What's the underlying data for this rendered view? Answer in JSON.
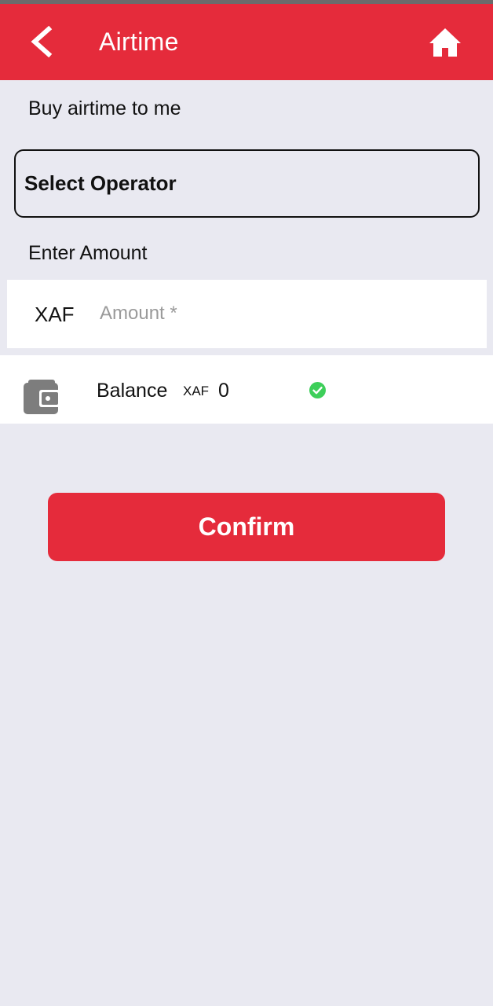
{
  "header": {
    "title": "Airtime",
    "back_icon": "chevron-left-icon",
    "home_icon": "home-icon",
    "background_color": "#e52b3b"
  },
  "form": {
    "buy_label": "Buy airtime to me",
    "operator_select_label": "Select Operator",
    "amount_label": "Enter Amount",
    "currency": "XAF",
    "amount_placeholder": "Amount *",
    "amount_value": ""
  },
  "balance": {
    "icon": "wallet-icon",
    "label": "Balance",
    "currency": "XAF",
    "value": "0",
    "status_icon": "check-circle-icon",
    "status_color": "#3ecf5a"
  },
  "actions": {
    "confirm_label": "Confirm",
    "confirm_color": "#e52b3b"
  }
}
